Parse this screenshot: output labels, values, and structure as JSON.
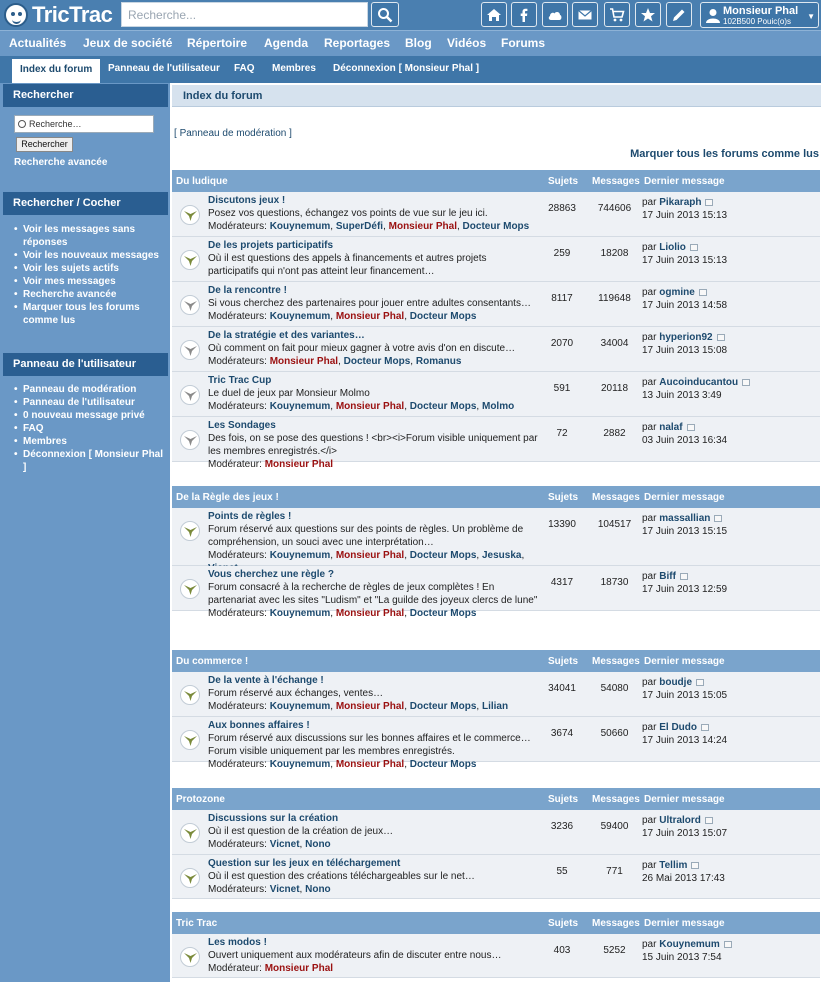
{
  "header": {
    "logo_text": "TricTrac",
    "search_placeholder": "Recherche...",
    "user_name": "Monsieur Phal",
    "user_points": "102B500 Pouic(o)s",
    "icons": [
      "home-icon",
      "facebook-icon",
      "cloud-icon",
      "mail-icon",
      "cart-icon",
      "star-icon",
      "pencil-icon"
    ]
  },
  "mainnav": [
    "Actualités",
    "Jeux de société",
    "Répertoire",
    "Agenda",
    "Reportages",
    "Blog",
    "Vidéos",
    "Forums"
  ],
  "subnav": [
    "Index du forum",
    "Panneau de l'utilisateur",
    "FAQ",
    "Membres",
    "Déconnexion [ Monsieur Phal ]"
  ],
  "sidebar": {
    "search_title": "Rechercher",
    "search_value": "Recherche…",
    "search_button": "Rechercher",
    "advanced_link": "Recherche avancée",
    "check_title": "Rechercher / Cocher",
    "check_links": [
      "Voir les messages sans réponses",
      "Voir les nouveaux messages",
      "Voir les sujets actifs",
      "Voir mes messages",
      "Recherche avancée",
      "Marquer tous les forums comme lus"
    ],
    "panel_title": "Panneau de l'utilisateur",
    "panel_links": [
      "Panneau de modération",
      "Panneau de l'utilisateur",
      "0 nouveau message privé",
      "FAQ",
      "Membres",
      "Déconnexion [ Monsieur Phal ]"
    ]
  },
  "content": {
    "breadcrumb": "Index du forum",
    "modpanel_open": "[",
    "modpanel_link": "Panneau de modération",
    "modpanel_close": "]",
    "mark_all": "Marquer tous les forums comme lus",
    "col_sujets": "Sujets",
    "col_messages": "Messages",
    "col_last": "Dernier message",
    "by": "par",
    "mods_label": "Modérateurs:",
    "mod_label": "Modérateur:"
  },
  "categories": [
    {
      "name": "Du ludique",
      "forums": [
        {
          "title": "Discutons jeux !",
          "desc": "Posez vos questions, échangez vos points de vue sur le jeu ici.",
          "mods": [
            "Kouynemum",
            "SuperDéfi",
            "Monsieur Phal",
            "Docteur Mops"
          ],
          "sujets": "28863",
          "messages": "744606",
          "last_user": "Pikaraph",
          "last_date": "17 Juin 2013 15:13"
        },
        {
          "title": "De les projets participatifs",
          "desc": "Où il est questions des appels à financements et autres projets participatifs qui n'ont pas atteint leur financement…",
          "mods": [],
          "sujets": "259",
          "messages": "18208",
          "last_user": "Liolio",
          "last_date": "17 Juin 2013 15:13"
        },
        {
          "title": "De la rencontre !",
          "desc": "Si vous cherchez des partenaires pour jouer entre adultes consentants…",
          "mods": [
            "Kouynemum",
            "Monsieur Phal",
            "Docteur Mops"
          ],
          "sujets": "8117",
          "messages": "119648",
          "last_user": "ogmine",
          "last_date": "17 Juin 2013 14:58"
        },
        {
          "title": "De la stratégie et des variantes…",
          "desc": "Où comment on fait pour mieux gagner à votre avis d'on en discute…",
          "mods": [
            "Monsieur Phal",
            "Docteur Mops",
            "Romanus"
          ],
          "sujets": "2070",
          "messages": "34004",
          "last_user": "hyperion92",
          "last_date": "17 Juin 2013 15:08"
        },
        {
          "title": "Tric Trac Cup",
          "desc": "Le duel de jeux par Monsieur Molmo",
          "mods": [
            "Kouynemum",
            "Monsieur Phal",
            "Docteur Mops",
            "Molmo"
          ],
          "sujets": "591",
          "messages": "20118",
          "last_user": "Aucoinducantou",
          "last_date": "13 Juin 2013 3:49"
        },
        {
          "title": "Les Sondages",
          "desc": "Des fois, on se pose des questions ! <br><i>Forum visible uniquement par les membres enregistrés.</i>",
          "mods": [
            "Monsieur Phal"
          ],
          "single": true,
          "sujets": "72",
          "messages": "2882",
          "last_user": "nalaf",
          "last_date": "03 Juin 2013 16:34"
        }
      ]
    },
    {
      "name": "De la Règle des jeux !",
      "forums": [
        {
          "title": "Points de règles !",
          "desc": "Forum réservé aux questions sur des points de règles. Un problème de compréhension, un souci avec une interprétation…",
          "mods": [
            "Kouynemum",
            "Monsieur Phal",
            "Docteur Mops",
            "Jesuska",
            "Vicnet"
          ],
          "sujets": "13390",
          "messages": "104517",
          "last_user": "massallian",
          "last_date": "17 Juin 2013 15:15"
        },
        {
          "title": "Vous cherchez une règle ?",
          "desc": "Forum consacré à la recherche de règles de jeux complètes ! En partenariat avec les sites \"Ludism\" et \"La guilde des joyeux clercs de lune\"",
          "mods": [
            "Kouynemum",
            "Monsieur Phal",
            "Docteur Mops"
          ],
          "sujets": "4317",
          "messages": "18730",
          "last_user": "Biff",
          "last_date": "17 Juin 2013 12:59"
        }
      ]
    },
    {
      "name": "Du commerce !",
      "forums": [
        {
          "title": "De la vente à l'échange !",
          "desc": "Forum réservé aux échanges, ventes…",
          "mods": [
            "Kouynemum",
            "Monsieur Phal",
            "Docteur Mops",
            "Lilian"
          ],
          "sujets": "34041",
          "messages": "54080",
          "last_user": "boudje",
          "last_date": "17 Juin 2013 15:05"
        },
        {
          "title": "Aux bonnes affaires !",
          "desc": "Forum réservé aux discussions sur les bonnes affaires et le commerce… Forum visible uniquement par les membres enregistrés.",
          "mods": [
            "Kouynemum",
            "Monsieur Phal",
            "Docteur Mops"
          ],
          "sujets": "3674",
          "messages": "50660",
          "last_user": "El Dudo",
          "last_date": "17 Juin 2013 14:24"
        }
      ]
    },
    {
      "name": "Protozone",
      "forums": [
        {
          "title": "Discussions sur la création",
          "desc": "Où il est question de la création de jeux…",
          "mods": [
            "Vicnet",
            "Nono"
          ],
          "sujets": "3236",
          "messages": "59400",
          "last_user": "Ultralord",
          "last_date": "17 Juin 2013 15:07"
        },
        {
          "title": "Question sur les jeux en téléchargement",
          "desc": "Où il est question des créations téléchargeables sur le net…",
          "mods": [
            "Vicnet",
            "Nono"
          ],
          "sujets": "55",
          "messages": "771",
          "last_user": "Tellim",
          "last_date": "26 Mai 2013 17:43"
        }
      ]
    },
    {
      "name": "Tric Trac",
      "forums": [
        {
          "title": "Les modos !",
          "desc": "Ouvert uniquement aux modérateurs afin de discuter entre nous…",
          "mods": [
            "Monsieur Phal"
          ],
          "single": true,
          "sujets": "403",
          "messages": "5252",
          "last_user": "Kouynemum",
          "last_date": "15 Juin 2013 7:54"
        }
      ]
    }
  ],
  "colors": {
    "topbar": "#4a7fb0",
    "nav": "#6a98c6",
    "subnav": "#3f76a8",
    "cat_head": "#7aa4cc",
    "link": "#1d4a6e",
    "mod_red": "#9a1010"
  }
}
